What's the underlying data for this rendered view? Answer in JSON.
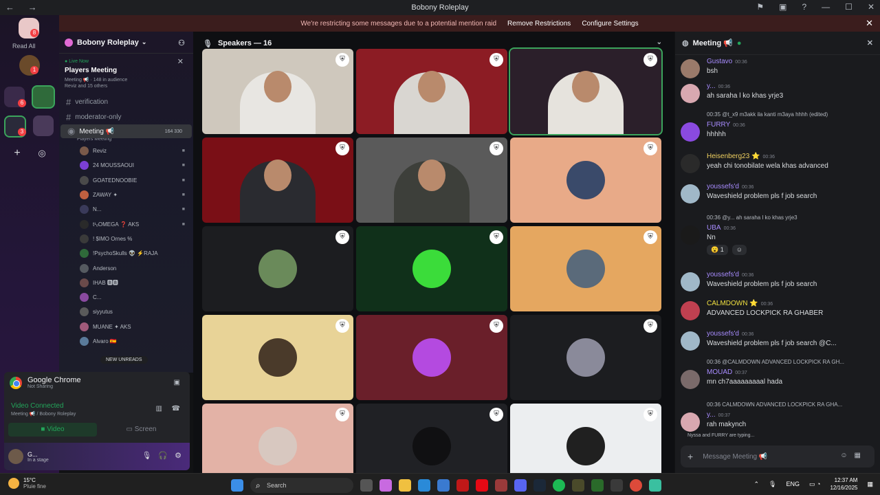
{
  "window": {
    "title": "Bobony Roleplay",
    "nav": "← →",
    "controls": [
      "⚑",
      "▣",
      "?",
      "—",
      "☐",
      "✕"
    ]
  },
  "banner": {
    "text": "We're restricting some messages due to a potential mention raid",
    "remove": "Remove Restrictions",
    "configure": "Configure Settings",
    "close": "✕"
  },
  "server_rail": {
    "read_all": "Read All",
    "badges": [
      "8",
      "1",
      "6",
      "3"
    ]
  },
  "sidebar": {
    "server_name": "Bobony Roleplay",
    "live": {
      "tag": "Live Now",
      "title": "Players Meeting",
      "meta": "Meeting 📢 · 148 in audience",
      "people": "Reviz and 15 others"
    },
    "channels": [
      {
        "name": "verification"
      },
      {
        "name": "moderator-only"
      }
    ],
    "meeting": {
      "name": "Meeting 📢",
      "sub": "Players Meeting",
      "counts": "164  330"
    },
    "users": [
      {
        "name": "Reviz",
        "color": "#7a5a4a"
      },
      {
        "name": "24 MOUSSAOUI",
        "color": "#7b3fd6"
      },
      {
        "name": "GOATEDNOOBIE",
        "color": "#4a4a4a"
      },
      {
        "name": "ZAWAY ✦",
        "color": "#c06040"
      },
      {
        "name": "N...",
        "color": "#3a3a5a"
      },
      {
        "name": "t¹ₒOMEGA ❓ AKS",
        "color": "#2a2a2a"
      },
      {
        "name": "! $IMO Ornes %",
        "color": "#3a3a3a"
      },
      {
        "name": "!PsychoSkulls 👽 ⚡RAJA",
        "color": "#2f6a3a"
      },
      {
        "name": "Anderson",
        "color": "#555a60"
      },
      {
        "name": "IHAB 🅱🅱",
        "color": "#6a4a4a"
      },
      {
        "name": "C...",
        "color": "#8a4aa0"
      },
      {
        "name": "siyyutus",
        "color": "#5a5a5a"
      },
      {
        "name": "MUANE ✦ AKS",
        "color": "#a05a7a"
      },
      {
        "name": "Alvaro 🇪🇸",
        "color": "#5a7a9a"
      }
    ],
    "new_unreads": "NEW UNREADS"
  },
  "voice": {
    "app": "Google Chrome",
    "sharing": "Not Sharing",
    "status": "Video Connected",
    "where": "Meeting 📢 / Bobony Roleplay",
    "video_btn": "Video",
    "screen_btn": "Screen"
  },
  "user": {
    "name": "G...",
    "status": "In a stage"
  },
  "stage": {
    "title": "Speakers — 16"
  },
  "tiles": [
    {
      "kind": "cam",
      "bg": "#cfc8bd",
      "shirt": "#e8e6e2",
      "sel": false
    },
    {
      "kind": "cam",
      "bg": "#8c1c24",
      "shirt": "#d9d6d1",
      "sel": false
    },
    {
      "kind": "cam",
      "bg": "#2b1f2a",
      "shirt": "#e6e3dd",
      "sel": true
    },
    {
      "kind": "cam",
      "bg": "#7a0f16",
      "shirt": "#2a2b30",
      "sel": false
    },
    {
      "kind": "cam",
      "bg": "#5a5a5a",
      "shirt": "#3d3f3a",
      "sel": false
    },
    {
      "kind": "avatar",
      "bg": "#e8aa88",
      "av": "#3a4a6a",
      "sel": false
    },
    {
      "kind": "avatar",
      "bg": "#1c1d20",
      "av": "#6a8a5a",
      "sel": false
    },
    {
      "kind": "avatar",
      "bg": "#10301a",
      "av": "#3bdc3a",
      "sel": false
    },
    {
      "kind": "avatar",
      "bg": "#e5a760",
      "av": "#5a6a7a",
      "sel": false
    },
    {
      "kind": "avatar",
      "bg": "#e8d397",
      "av": "#4a3a2a",
      "sel": false
    },
    {
      "kind": "avatar",
      "bg": "#6a1f2a",
      "av": "#b44ae0",
      "sel": false
    },
    {
      "kind": "avatar",
      "bg": "#1c1d20",
      "av": "#8a8a9a",
      "sel": false
    },
    {
      "kind": "avatar",
      "bg": "#e3b2a6",
      "av": "#d8c8c0",
      "sel": false
    },
    {
      "kind": "avatar",
      "bg": "#202125",
      "av": "#101012",
      "sel": false
    },
    {
      "kind": "avatar",
      "bg": "#eceef0",
      "av": "#202020",
      "sel": false
    }
  ],
  "chat": {
    "title": "Meeting 📢",
    "messages": [
      {
        "name": "Gustavo",
        "color": "#a88cff",
        "time": "00:36",
        "text": "bsh",
        "reply": "",
        "av": "#9a7a6a"
      },
      {
        "name": "y...",
        "color": "#a88cff",
        "time": "00:36",
        "text": "ah saraha l ko khas yrje3",
        "reply": "",
        "av": "#d8a8b0"
      },
      {
        "name": "FURRY",
        "color": "#a88cff",
        "time": "00:36",
        "text": "hhhhh",
        "reply": "00:35 @t_x9 m3akk ila kanti m3aya hhhh (edited)",
        "av": "#8a4ae0"
      },
      {
        "name": "Heisenberg23 ⭐",
        "color": "#f0d060",
        "time": "00:36",
        "text": "yeah chi tonobilate wela khas advanced",
        "reply": "",
        "av": "#2a2a2a"
      },
      {
        "name": "youssefs'd",
        "color": "#a88cff",
        "time": "00:36",
        "text": "Waveshield problem pls f job search",
        "reply": "",
        "av": "#a0b8c8"
      },
      {
        "name": "UBA",
        "color": "#a88cff",
        "time": "00:36",
        "text": "Nn",
        "reply": "00:36 @y... ah saraha l ko khas yrje3",
        "av": "#1a1a1a"
      },
      {
        "name": "youssefs'd",
        "color": "#a88cff",
        "time": "00:36",
        "text": "Waveshield problem pls f job search",
        "reply": "",
        "av": "#a0b8c8"
      },
      {
        "name": "CALMDOWN ⭐",
        "color": "#f0e040",
        "time": "00:36",
        "text": "ADVANCED LOCKPICK RA GHABER",
        "reply": "",
        "av": "#c04050"
      },
      {
        "name": "youssefs'd",
        "color": "#a88cff",
        "time": "00:36",
        "text": "Waveshield problem pls f job search @C...",
        "reply": "",
        "av": "#a0b8c8"
      },
      {
        "name": "MOUAD",
        "color": "#a88cff",
        "time": "00:37",
        "text": "mn ch7aaaaaaaaal hada",
        "reply": "00:36 @CALMDOWN ADVANCED LOCKPICK RA GH...",
        "av": "#7a6a6a"
      },
      {
        "name": "y...",
        "color": "#a88cff",
        "time": "00:37",
        "text": "rah makynch",
        "reply": "00:36 CALMDOWN ADVANCED LOCKPICK RA GHA...",
        "av": "#d8a8b0"
      }
    ],
    "reactions": [
      "😮 1",
      "☺"
    ],
    "typing": "Nyssa and FURRY are typing...",
    "placeholder": "Message Meeting 📢"
  },
  "taskbar": {
    "temp": "15°C",
    "weather": "Pluie fine",
    "search": "Search",
    "lang": "ENG",
    "time": "12:37 AM",
    "date": "12/16/2025"
  }
}
